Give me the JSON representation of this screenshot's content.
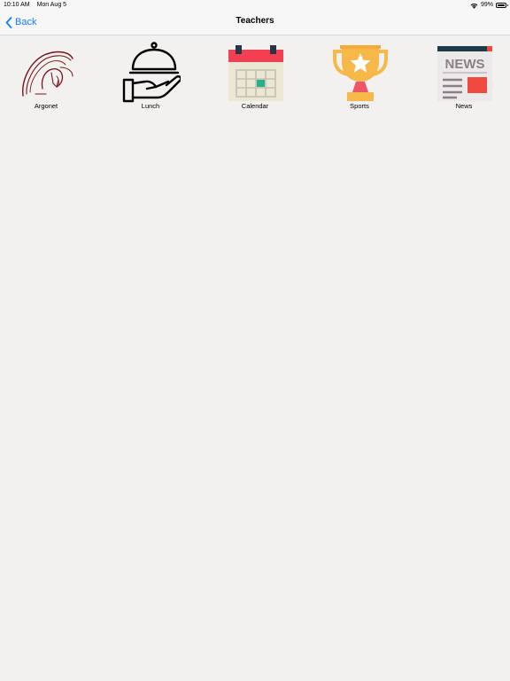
{
  "status_bar": {
    "time": "10:10 AM",
    "date": "Mon Aug 5",
    "battery_percent": "99%",
    "battery_level": 0.99,
    "wifi_icon": "wifi-icon",
    "battery_icon": "battery-icon"
  },
  "nav": {
    "back_label": "Back",
    "back_icon": "chevron-left-icon",
    "title": "Teachers"
  },
  "tiles": [
    {
      "label": "Argonet",
      "icon": "spartan-helmet-icon"
    },
    {
      "label": "Lunch",
      "icon": "serving-cloche-icon"
    },
    {
      "label": "Calendar",
      "icon": "calendar-icon"
    },
    {
      "label": "Sports",
      "icon": "trophy-icon"
    },
    {
      "label": "News",
      "icon": "newspaper-icon"
    }
  ],
  "icon_text": {
    "news_heading": "NEWS"
  },
  "colors": {
    "accent": "#147efb",
    "background": "#f2f1f0",
    "helmet": "#7a1416",
    "calendar_header": "#f23f51",
    "calendar_highlight": "#25b08c",
    "trophy": "#f7b84a",
    "news_header": "#1d3c47",
    "news_accent": "#ef4940"
  }
}
